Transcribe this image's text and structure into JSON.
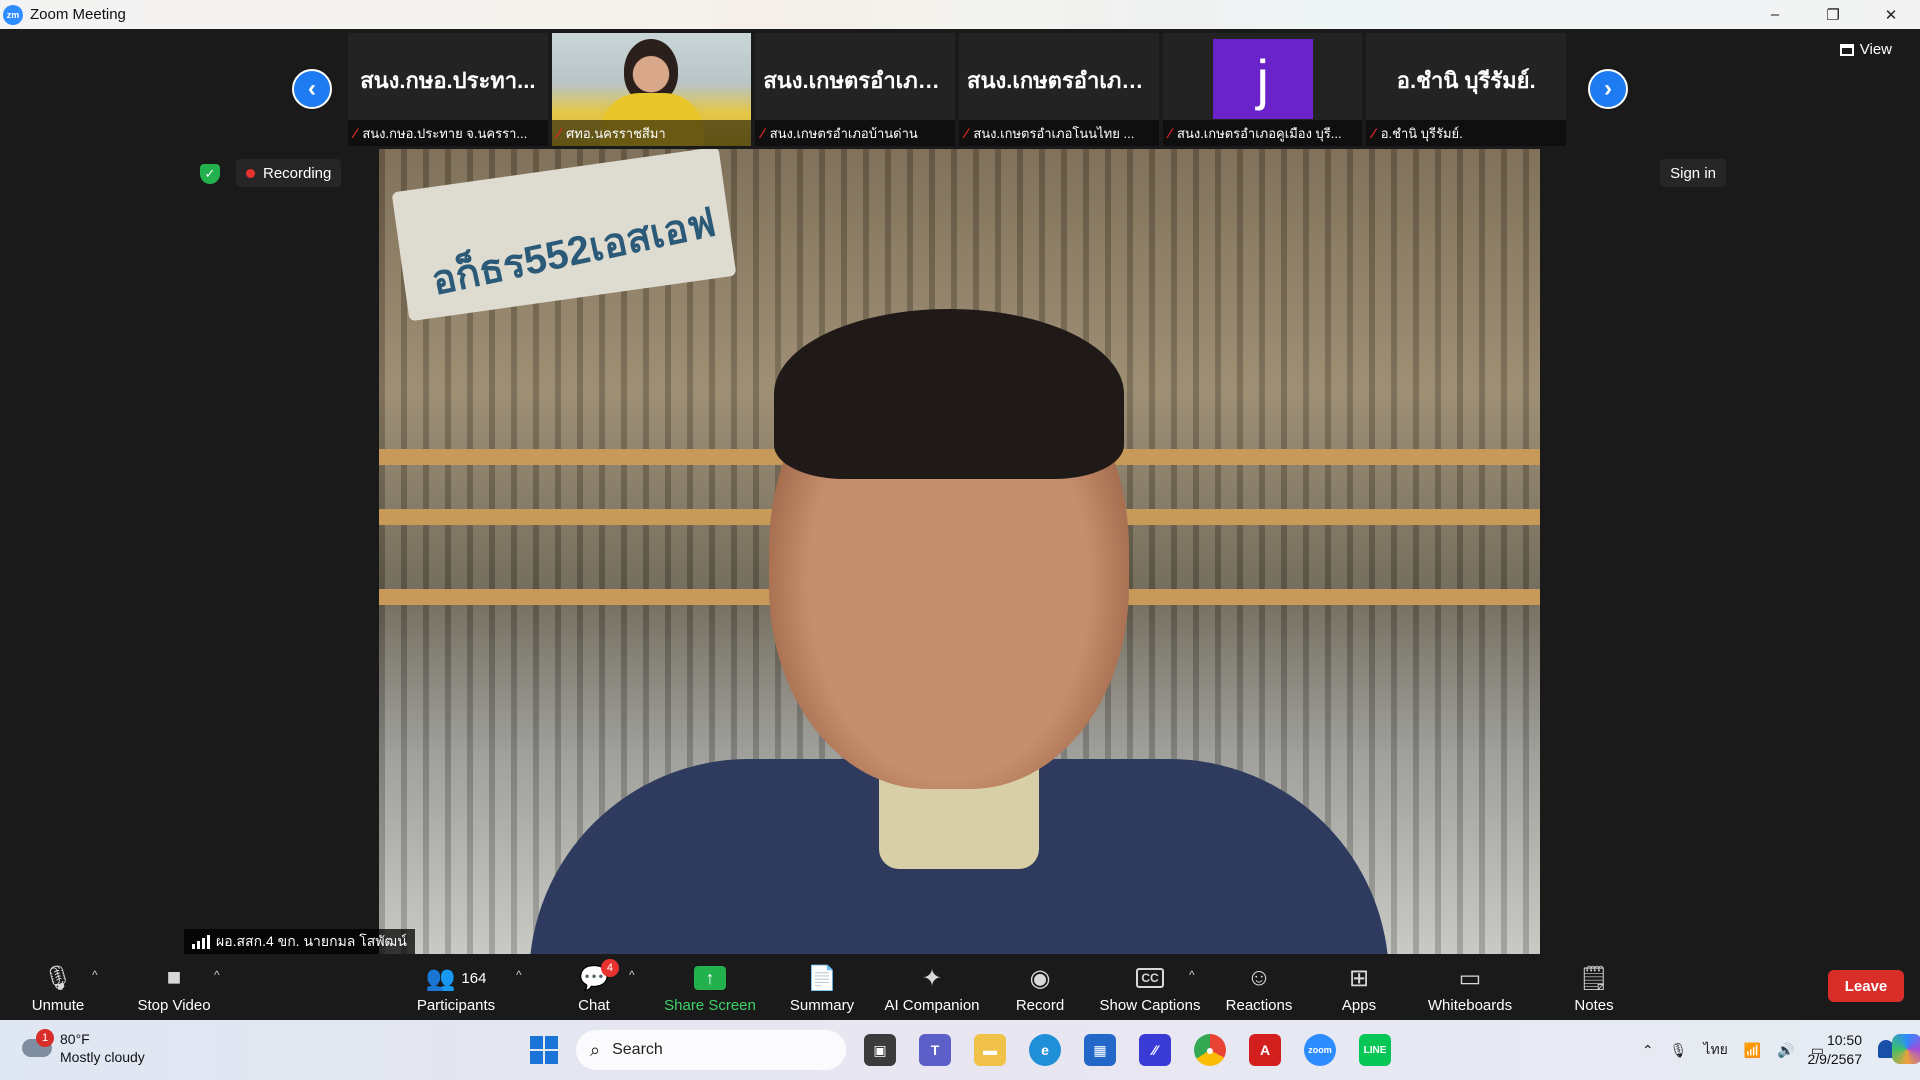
{
  "window": {
    "app_icon": "zm",
    "title": "Zoom Meeting",
    "controls": [
      "–",
      "❐",
      "✕"
    ]
  },
  "gallery": {
    "prev_icon": "chevron-left-icon",
    "next_icon": "chevron-right-icon",
    "view_label": "View",
    "tiles": [
      {
        "display": "สนง.กษอ.ประทา...",
        "label": "สนง.กษอ.ประทาย จ.นครรา...",
        "type": "name"
      },
      {
        "display": "",
        "label": "ศทอ.นครราชสีมา",
        "type": "video"
      },
      {
        "display": "สนง.เกษตรอำเภอ...",
        "label": "สนง.เกษตรอำเภอบ้านด่าน",
        "type": "name"
      },
      {
        "display": "สนง.เกษตรอำเภอ...",
        "label": "สนง.เกษตรอำเภอโนนไทย ...",
        "type": "name"
      },
      {
        "display": "j",
        "label": "สนง.เกษตรอำเภอคูเมือง บุรี...",
        "type": "avatar"
      },
      {
        "display": "อ.ชำนิ บุรีรัมย์.",
        "label": "อ.ชำนิ บุรีรัมย์.",
        "type": "name"
      }
    ]
  },
  "status": {
    "security_icon": "shield-icon",
    "recording_label": "Recording",
    "sign_in_label": "Sign in"
  },
  "active_speaker": {
    "label": "ผอ.สสก.4 ขก. นายกมล โสพัฒน์",
    "sack_text": "อก็ธร552เอสเอฟ"
  },
  "toolbar": {
    "unmute": "Unmute",
    "stop_video": "Stop Video",
    "participants": "Participants",
    "participants_count": "164",
    "chat": "Chat",
    "chat_badge": "4",
    "share_screen": "Share Screen",
    "summary": "Summary",
    "ai_companion": "AI Companion",
    "record": "Record",
    "show_captions": "Show Captions",
    "captions_icon_text": "CC",
    "reactions": "Reactions",
    "apps": "Apps",
    "whiteboards": "Whiteboards",
    "notes": "Notes",
    "leave": "Leave"
  },
  "taskbar": {
    "weather_badge": "1",
    "temperature": "80°F",
    "condition": "Mostly cloudy",
    "search_placeholder": "Search",
    "language": "ไทย",
    "time": "10:50",
    "date": "2/9/2567",
    "colors": {
      "zoom_blue": "#2d8cff",
      "leave_red": "#d92d2a",
      "share_green": "#22b14c"
    }
  }
}
